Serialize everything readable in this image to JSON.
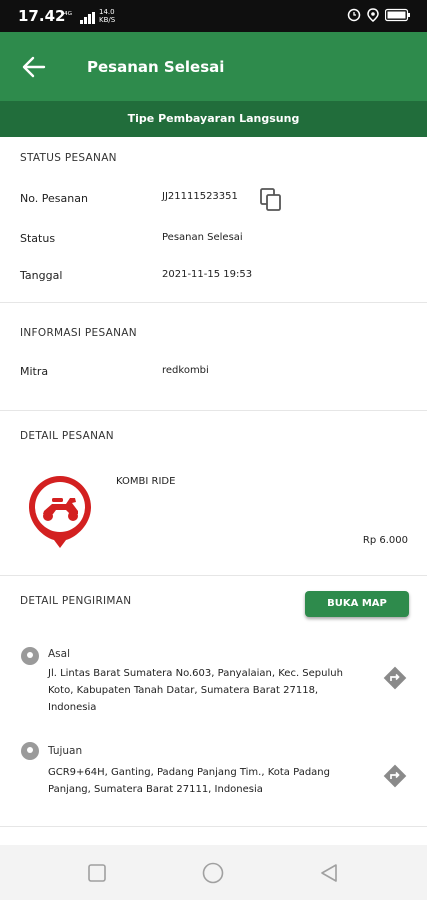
{
  "status_bar": {
    "time": "17.42",
    "net_speed": "14.0",
    "net_unit": "KB/S"
  },
  "app_bar": {
    "title": "Pesanan Selesai"
  },
  "payment_banner": "Tipe Pembayaran Langsung",
  "order_status": {
    "heading": "STATUS PESANAN",
    "order_no_label": "No. Pesanan",
    "order_no_value": "JJ21111523351",
    "status_label": "Status",
    "status_value": "Pesanan Selesai",
    "date_label": "Tanggal",
    "date_value": "2021-11-15 19:53"
  },
  "order_info": {
    "heading": "INFORMASI PESANAN",
    "partner_label": "Mitra",
    "partner_value": "redkombi"
  },
  "order_detail": {
    "heading": "DETAIL PESANAN",
    "service_name": "KOMBI RIDE",
    "price": "Rp 6.000"
  },
  "delivery": {
    "heading": "DETAIL PENGIRIMAN",
    "map_button": "BUKA MAP",
    "origin_label": "Asal",
    "origin_address": "Jl. Lintas Barat Sumatera No.603, Panyalaian, Kec. Sepuluh Koto, Kabupaten Tanah Datar, Sumatera Barat 27118, Indonesia",
    "destination_label": "Tujuan",
    "destination_address": "GCR9+64H, Ganting, Padang Panjang Tim., Kota Padang Panjang, Sumatera Barat 27111, Indonesia"
  },
  "colors": {
    "primary": "#2e8b4c",
    "primary_dark": "#216d3b",
    "brand_red": "#d32020"
  }
}
